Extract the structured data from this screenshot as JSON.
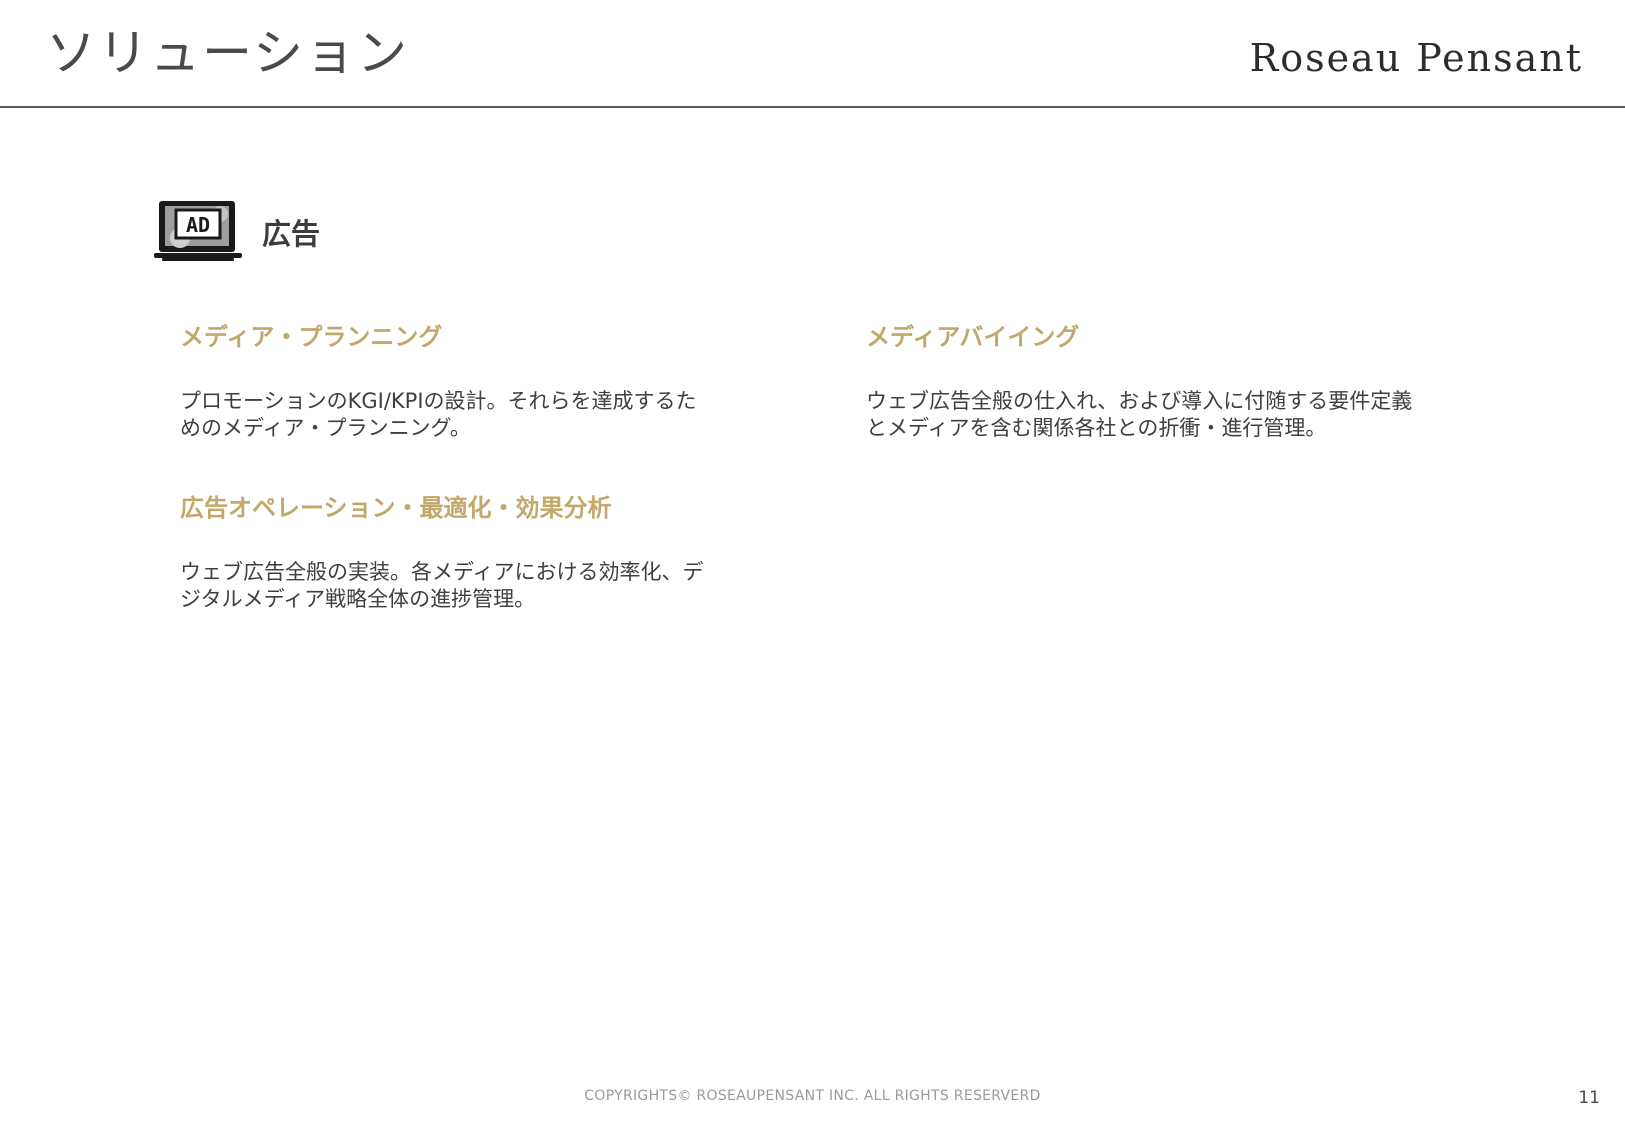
{
  "header": {
    "title": "ソリューション",
    "brand": "Roseau Pensant"
  },
  "section": {
    "icon": "ad-laptop-icon",
    "icon_text": "AD",
    "title": "広告"
  },
  "items": [
    {
      "title": "メディア・プランニング",
      "desc_lines": [
        "プロモーションのKGI/KPIの設計。それらを達成するた",
        "めのメディア・プランニング。"
      ]
    },
    {
      "title": "メディアバイイング",
      "desc_lines": [
        "ウェブ広告全般の仕入れ、および導入に付随する要件定義",
        "とメディアを含む関係各社との折衝・進行管理。"
      ]
    },
    {
      "title": "広告オペレーション・最適化・効果分析",
      "desc_lines": [
        "ウェブ広告全般の実装。各メディアにおける効率化、デ",
        "ジタルメディア戦略全体の進捗管理。"
      ]
    }
  ],
  "footer": {
    "copyright": "COPYRIGHTS© ROSEAUPENSANT INC. ALL RIGHTS RESERVERD",
    "page_number": "11"
  },
  "colors": {
    "accent": "#c2a86a",
    "text": "#3f3f3f",
    "rule": "#5a5a5a"
  }
}
